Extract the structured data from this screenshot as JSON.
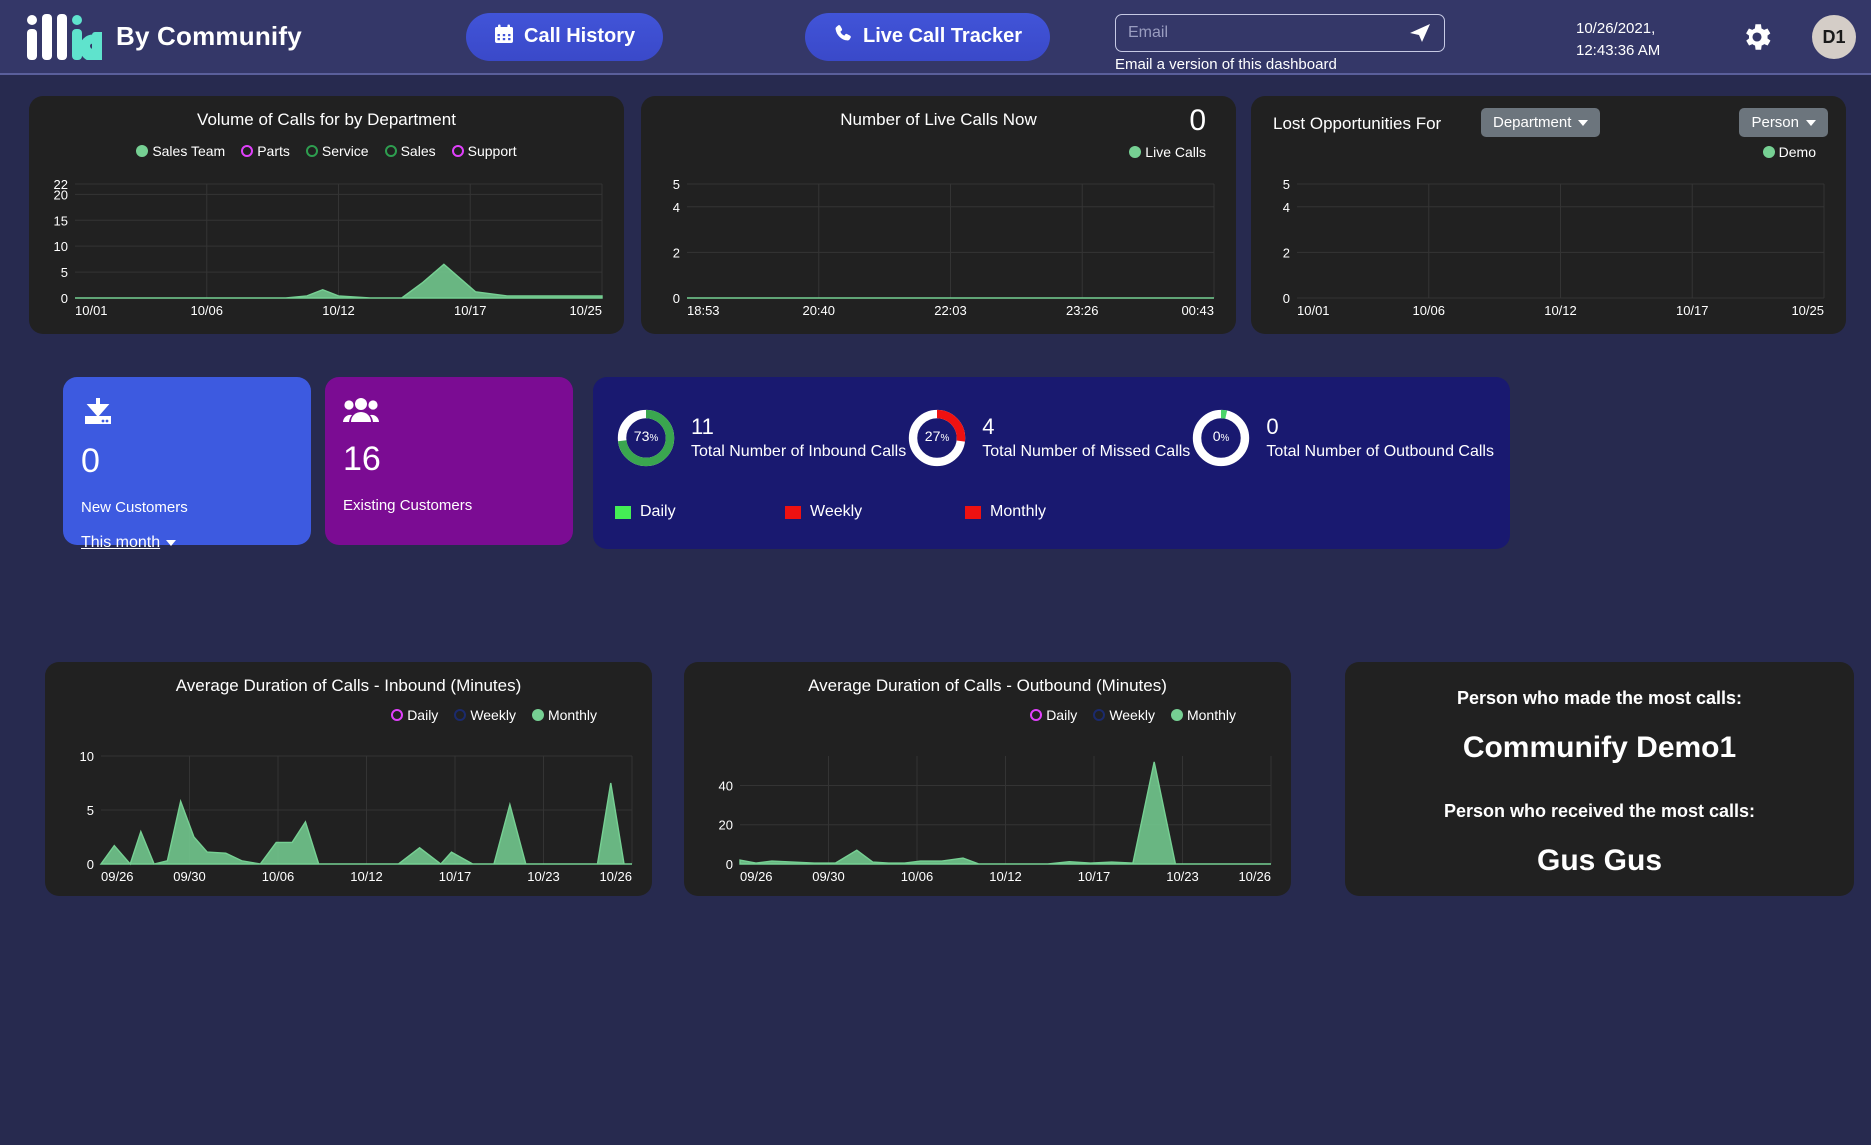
{
  "header": {
    "logo_text": "illia",
    "brand": "By Communify",
    "call_history_label": "Call History",
    "live_call_tracker_label": "Live Call Tracker",
    "email_placeholder": "Email",
    "email_value": "",
    "email_note": "Email a version of this dashboard",
    "date": "10/26/2021,",
    "time": "12:43:36 AM",
    "avatar_initials": "D1",
    "icons": {
      "calendar": "calendar-icon",
      "phone": "phone-icon",
      "send": "send-icon",
      "gear": "gear-icon"
    },
    "colors": {
      "bar": "#343768",
      "button": "#4154d8",
      "logo_teal": "#5fe3cd"
    }
  },
  "volume_chart": {
    "title": "Volume of Calls for by Department",
    "legend": [
      {
        "label": "Sales Team",
        "marker": "filled",
        "color": "#76d093"
      },
      {
        "label": "Parts",
        "marker": "outline",
        "color": "#e040fb"
      },
      {
        "label": "Service",
        "marker": "outline",
        "color": "#2e9e4f"
      },
      {
        "label": "Sales",
        "marker": "outline",
        "color": "#2e9e4f"
      },
      {
        "label": "Support",
        "marker": "outline",
        "color": "#e040fb"
      }
    ]
  },
  "live_chart": {
    "title": "Number of Live Calls Now",
    "value": "0",
    "legend": [
      {
        "label": "Live Calls",
        "marker": "filled",
        "color": "#76d093"
      }
    ]
  },
  "lost_chart": {
    "title": "Lost Opportunities For",
    "department_dropdown": "Department",
    "person_dropdown": "Person",
    "legend": [
      {
        "label": "Demo",
        "marker": "filled",
        "color": "#76d093"
      }
    ]
  },
  "tiles": [
    {
      "name": "new-customers",
      "icon": "download-inbox-icon",
      "value": "0",
      "caption": "New Customers",
      "selector": "This month",
      "color": "#3d5ae0"
    },
    {
      "name": "existing-customers",
      "icon": "people-group-icon",
      "value": "16",
      "caption": "Existing Customers",
      "color": "#7b0c93"
    }
  ],
  "donuts": {
    "items": [
      {
        "percent": "73",
        "percent_symbol": "%",
        "number": "11",
        "label": "Total Number of Inbound Calls",
        "color": "#3aa64f",
        "value": 73
      },
      {
        "percent": "27",
        "percent_symbol": "%",
        "number": "4",
        "label": "Total Number of Missed Calls",
        "color": "#ee1111",
        "value": 27
      },
      {
        "percent": "0",
        "percent_symbol": "%",
        "number": "0",
        "label": "Total Number of Outbound Calls",
        "color": "#4bd46a",
        "value": 2
      }
    ],
    "legend": [
      {
        "label": "Daily",
        "color": "#44ee55"
      },
      {
        "label": "Weekly",
        "color": "#ee1111"
      },
      {
        "label": "Monthly",
        "color": "#ee1111"
      }
    ]
  },
  "inbound_chart": {
    "title": "Average Duration of Calls - Inbound (Minutes)",
    "legend": [
      {
        "label": "Daily",
        "marker": "outline",
        "color": "#e040fb"
      },
      {
        "label": "Weekly",
        "marker": "outline",
        "color": "#1b2a6b"
      },
      {
        "label": "Monthly",
        "marker": "filled",
        "color": "#76d093"
      }
    ]
  },
  "outbound_chart": {
    "title": "Average Duration of Calls - Outbound (Minutes)",
    "legend": [
      {
        "label": "Daily",
        "marker": "outline",
        "color": "#e040fb"
      },
      {
        "label": "Weekly",
        "marker": "outline",
        "color": "#1b2a6b"
      },
      {
        "label": "Monthly",
        "marker": "filled",
        "color": "#76d093"
      }
    ]
  },
  "top_people": {
    "made_label": "Person who made the most calls:",
    "made_name": "Communify Demo1",
    "received_label": "Person who received the most calls:",
    "received_name": "Gus Gus"
  },
  "chart_data": [
    {
      "type": "area",
      "id": "volume-of-calls",
      "title": "Volume of Calls for by Department",
      "xlabel": "",
      "ylabel": "",
      "ylim": [
        0,
        22
      ],
      "yticks": [
        "22",
        "20",
        "15",
        "10",
        "5",
        "0"
      ],
      "ytick_values": [
        22,
        20,
        15,
        10,
        5,
        0
      ],
      "xticks": [
        "10/01",
        "10/06",
        "10/12",
        "10/17",
        "10/25"
      ],
      "grid": true,
      "legend_position": "top-right",
      "series": [
        {
          "name": "Sales Team",
          "color": "#76d093",
          "x": [
            0,
            0.4,
            0.44,
            0.47,
            0.5,
            0.56,
            0.62,
            0.66,
            0.7,
            0.76,
            0.82,
            1.0
          ],
          "values": [
            0,
            0,
            0.4,
            1.6,
            0.4,
            0,
            0,
            3.0,
            6.5,
            1.2,
            0.4,
            0.4
          ]
        }
      ]
    },
    {
      "type": "line",
      "id": "live-calls-now",
      "title": "Number of Live Calls Now",
      "headline_value": 0,
      "ylim": [
        0,
        5
      ],
      "yticks": [
        "5",
        "4",
        "2",
        "0"
      ],
      "ytick_values": [
        5,
        4,
        2,
        0
      ],
      "xticks": [
        "18:53",
        "20:40",
        "22:03",
        "23:26",
        "00:43"
      ],
      "grid": true,
      "legend_position": "top-right",
      "series": [
        {
          "name": "Live Calls",
          "color": "#76d093",
          "x": [
            0,
            0.25,
            0.5,
            0.75,
            1.0
          ],
          "values": [
            0,
            0,
            0,
            0,
            0
          ]
        }
      ]
    },
    {
      "type": "line",
      "id": "lost-opportunities",
      "title": "Lost Opportunities For",
      "ylim": [
        0,
        5
      ],
      "yticks": [
        "5",
        "4",
        "2",
        "0"
      ],
      "ytick_values": [
        5,
        4,
        2,
        0
      ],
      "xticks": [
        "10/01",
        "10/06",
        "10/12",
        "10/17",
        "10/25"
      ],
      "grid": true,
      "legend_position": "top-right",
      "series": [
        {
          "name": "Demo",
          "color": "#76d093",
          "x": [],
          "values": []
        }
      ]
    },
    {
      "type": "area",
      "id": "avg-duration-inbound",
      "title": "Average Duration of Calls - Inbound (Minutes)",
      "ylabel": "Minutes",
      "ylim": [
        0,
        10
      ],
      "yticks": [
        "10",
        "5",
        "0"
      ],
      "ytick_values": [
        10,
        5,
        0
      ],
      "xticks": [
        "09/26",
        "09/30",
        "10/06",
        "10/12",
        "10/17",
        "10/23",
        "10/26"
      ],
      "grid": true,
      "legend_position": "top-right",
      "series": [
        {
          "name": "Monthly",
          "color": "#76d093",
          "x": [
            0.0,
            0.025,
            0.055,
            0.075,
            0.1,
            0.125,
            0.15,
            0.175,
            0.2,
            0.235,
            0.265,
            0.3,
            0.33,
            0.36,
            0.385,
            0.41,
            0.44,
            0.47,
            0.5,
            0.53,
            0.56,
            0.6,
            0.64,
            0.66,
            0.7,
            0.74,
            0.77,
            0.8,
            0.83,
            0.87,
            0.9,
            0.935,
            0.96,
            0.985,
            1.0
          ],
          "values": [
            0.0,
            1.7,
            0.0,
            3.0,
            0.0,
            0.3,
            5.8,
            2.5,
            1.1,
            1.0,
            0.3,
            0.0,
            2.0,
            2.0,
            3.9,
            0.0,
            0.0,
            0.0,
            0.0,
            0.0,
            0.0,
            1.5,
            0.0,
            1.1,
            0.0,
            0.0,
            5.5,
            0.0,
            0.0,
            0.0,
            0.0,
            0.0,
            7.5,
            0.0,
            0.0
          ]
        }
      ]
    },
    {
      "type": "area",
      "id": "avg-duration-outbound",
      "title": "Average Duration of Calls - Outbound (Minutes)",
      "ylabel": "Minutes",
      "ylim": [
        0,
        55
      ],
      "yticks": [
        "40",
        "20",
        "0"
      ],
      "ytick_values": [
        40,
        20,
        0
      ],
      "xticks": [
        "09/26",
        "09/30",
        "10/06",
        "10/12",
        "10/17",
        "10/23",
        "10/26"
      ],
      "grid": true,
      "legend_position": "top-right",
      "series": [
        {
          "name": "Monthly",
          "color": "#76d093",
          "x": [
            0.0,
            0.03,
            0.06,
            0.1,
            0.14,
            0.18,
            0.22,
            0.25,
            0.28,
            0.31,
            0.34,
            0.38,
            0.42,
            0.45,
            0.5,
            0.54,
            0.58,
            0.62,
            0.66,
            0.7,
            0.74,
            0.78,
            0.82,
            0.85,
            0.88,
            0.92,
            0.96,
            1.0
          ],
          "values": [
            2.0,
            0.5,
            1.5,
            1.0,
            0.5,
            0.5,
            7.0,
            1.0,
            0.5,
            0.5,
            1.5,
            1.5,
            3.0,
            0.0,
            0.0,
            0.0,
            0.0,
            1.2,
            0.5,
            1.0,
            0.5,
            52.0,
            0.0,
            0.0,
            0.0,
            0.0,
            0.0,
            0.0
          ]
        }
      ]
    },
    {
      "type": "pie",
      "id": "call-breakdown-donuts",
      "title": "",
      "slices": [
        {
          "label": "Total Number of Inbound Calls",
          "percent": 73,
          "count": 11,
          "color": "#3aa64f"
        },
        {
          "label": "Total Number of Missed Calls",
          "percent": 27,
          "count": 4,
          "color": "#ee1111"
        },
        {
          "label": "Total Number of Outbound Calls",
          "percent": 0,
          "count": 0,
          "color": "#4bd46a"
        }
      ]
    }
  ]
}
